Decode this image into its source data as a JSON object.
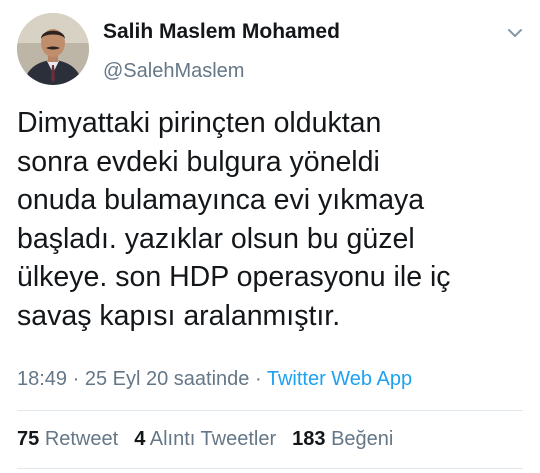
{
  "author": {
    "name": "Salih Maslem Mohamed",
    "handle": "@SalehMaslem"
  },
  "tweet": {
    "lines": [
      "Dimyattaki pirinçten olduktan",
      "sonra evdeki bulgura yöneldi",
      "onuda bulamayınca evi yıkmaya",
      "başladı. yazıklar olsun bu güzel",
      "ülkeye. son HDP operasyonu ile iç",
      "savaş kapısı aralanmıştır."
    ],
    "time": "18:49",
    "separator1": " · ",
    "date": "25 Eyl 20 saatinde",
    "separator2": " · ",
    "source": "Twitter Web App"
  },
  "stats": {
    "retweets_count": "75",
    "retweets_label": "Retweet",
    "quotes_count": "4",
    "quotes_label": "Alıntı Tweetler",
    "likes_count": "183",
    "likes_label": "Beğeni"
  },
  "colors": {
    "link": "#1da1f2",
    "secondary_text": "#657786",
    "primary_text": "#14171a"
  },
  "icons": {
    "menu": "chevron-down-icon"
  }
}
